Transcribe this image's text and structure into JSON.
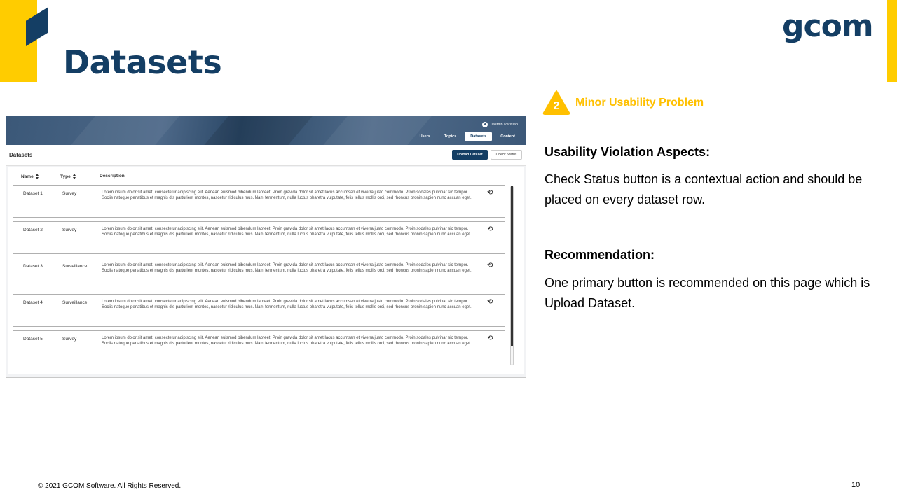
{
  "slide": {
    "title": "Datasets",
    "logo": "gcom",
    "footer": "© 2021 GCOM Software. All Rights Reserved.",
    "page_number": "10",
    "colors": {
      "navy": "#143e64",
      "yellow": "#ffcc00",
      "badge_yellow": "#ffc000"
    }
  },
  "screenshot": {
    "user_name": "Jasmin Parisian",
    "nav": [
      "Users",
      "Topics",
      "Datasets",
      "Content"
    ],
    "active_nav": "Datasets",
    "page_title": "Datasets",
    "upload_button": "Upload Dataset",
    "check_status_button": "Check Status",
    "columns": {
      "name": "Name",
      "type": "Type",
      "description": "Description"
    },
    "rows": [
      {
        "name": "Dataset 1",
        "type": "Survey",
        "description": "Lorem ipsum dolor sit amet, consectetur adipiscing elit. Aenean euismod bibendum laoreet. Proin gravida dolor sit amet lacus accumsan et viverra justo commodo. Proin sodales pulvinar sic tempor. Sociis natoque penatibus et magnis dis parturient montes, nascetur ridiculus mus. Nam fermentum, nulla luctus pharetra vulputate, felis tellus mollis orci, sed rhoncus pronin sapien nunc accuan eget."
      },
      {
        "name": "Dataset 2",
        "type": "Survey",
        "description": "Lorem ipsum dolor sit amet, consectetur adipiscing elit. Aenean euismod bibendum laoreet. Proin gravida dolor sit amet lacus accumsan et viverra justo commodo. Proin sodales pulvinar sic tempor. Sociis natoque penatibus et magnis dis parturient montes, nascetur ridiculus mus. Nam fermentum, nulla luctus pharetra vulputate, felis tellus mollis orci, sed rhoncus pronin sapien nunc accuan eget."
      },
      {
        "name": "Dataset 3",
        "type": "Surveillance",
        "description": "Lorem ipsum dolor sit amet, consectetur adipiscing elit. Aenean euismod bibendum laoreet. Proin gravida dolor sit amet lacus accumsan et viverra justo commodo. Proin sodales pulvinar sic tempor. Sociis natoque penatibus et magnis dis parturient montes, nascetur ridiculus mus. Nam fermentum, nulla luctus pharetra vulputate, felis tellus mollis orci, sed rhoncus pronin sapien nunc accuan eget."
      },
      {
        "name": "Dataset 4",
        "type": "Surveillance",
        "description": "Lorem ipsum dolor sit amet, consectetur adipiscing elit. Aenean euismod bibendum laoreet. Proin gravida dolor sit amet lacus accumsan et viverra justo commodo. Proin sodales pulvinar sic tempor. Sociis natoque penatibus et magnis dis parturient montes, nascetur ridiculus mus. Nam fermentum, nulla luctus pharetra vulputate, felis tellus mollis orci, sed rhoncus pronin sapien nunc accuan eget."
      },
      {
        "name": "Dataset 5",
        "type": "Survey",
        "description": "Lorem ipsum dolor sit amet, consectetur adipiscing elit. Aenean euismod bibendum laoreet. Proin gravida dolor sit amet lacus accumsan et viverra justo commodo. Proin sodales pulvinar sic tempor. Sociis natoque penatibus et magnis dis parturient montes, nascetur ridiculus mus. Nam fermentum, nulla luctus pharetra vulputate, felis tellus mollis orci, sed rhoncus pronin sapien nunc accuan eget."
      }
    ],
    "status_icon": "refresh-icon"
  },
  "finding": {
    "severity_number": "2",
    "severity_label": "Minor Usability Problem",
    "violation_heading": "Usability Violation Aspects:",
    "violation_text": "Check Status button is a contextual action and should be placed on every dataset row.",
    "recommendation_heading": "Recommendation:",
    "recommendation_text": "One primary button is recommended on this page which is Upload Dataset."
  }
}
